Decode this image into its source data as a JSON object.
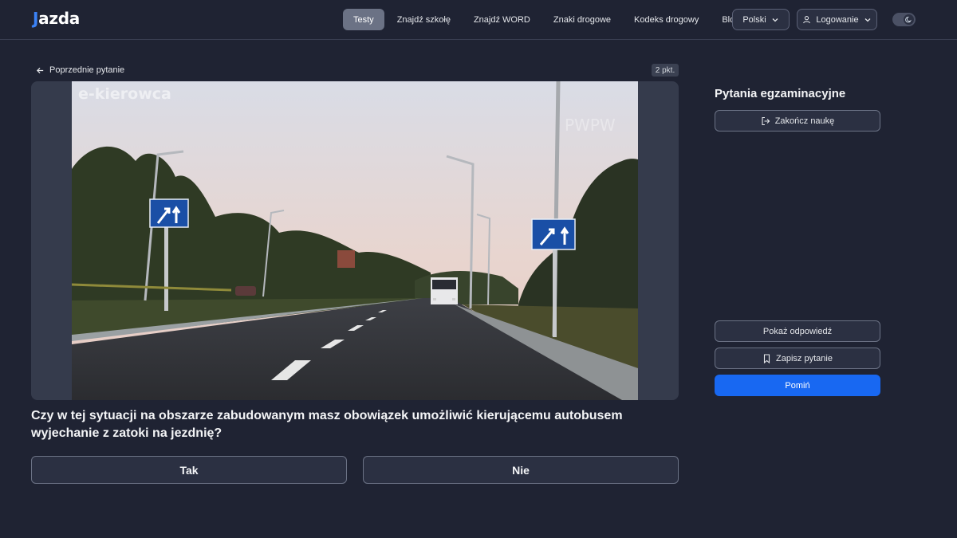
{
  "header": {
    "logo_first": "J",
    "logo_rest": "azda",
    "nav": [
      {
        "label": "Testy",
        "active": true
      },
      {
        "label": "Znajdź szkołę"
      },
      {
        "label": "Znajdź WORD"
      },
      {
        "label": "Znaki drogowe"
      },
      {
        "label": "Kodeks drogowy"
      },
      {
        "label": "Blog"
      }
    ],
    "language": "Polski",
    "login": "Logowanie",
    "theme_icon": "moon-icon"
  },
  "main": {
    "prev_label": "Poprzednie pytanie",
    "points": "2 pkt.",
    "watermark": "e-kierowca",
    "watermark_right": "PWPW",
    "question": "Czy w tej sytuacji na obszarze zabudowanym masz obowiązek umożliwić kierującemu autobusem wyjechanie z zatoki na jezdnię?",
    "answers": {
      "yes": "Tak",
      "no": "Nie"
    }
  },
  "sidebar": {
    "title": "Pytania egzaminacyjne",
    "finish": "Zakończ naukę",
    "show_answer": "Pokaż odpowiedź",
    "save_question": "Zapisz pytanie",
    "skip": "Pomiń"
  },
  "colors": {
    "background": "#1f2333",
    "accent": "#1868f2",
    "logo_accent": "#3b82f6"
  }
}
